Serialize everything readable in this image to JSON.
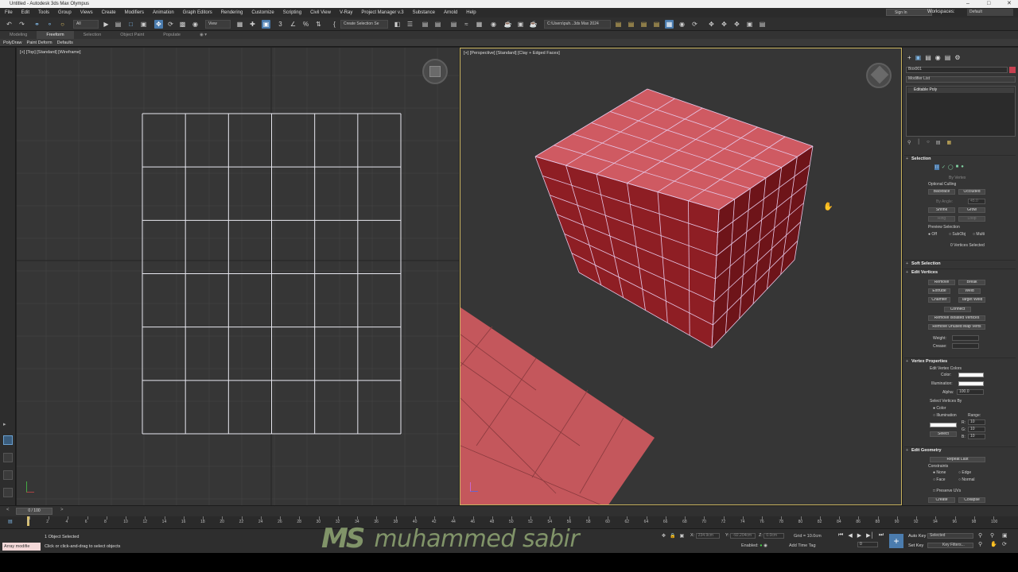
{
  "window": {
    "title": "Untitled - Autodesk 3ds Max Olympus"
  },
  "menu": [
    "File",
    "Edit",
    "Tools",
    "Group",
    "Views",
    "Create",
    "Modifiers",
    "Animation",
    "Graph Editors",
    "Rendering",
    "Customize",
    "Scripting",
    "Civil View",
    "V-Ray",
    "Project Manager v.3",
    "Substance",
    "Arnold",
    "Help"
  ],
  "account": {
    "signin": "Sign In",
    "workspaces_label": "Workspaces:",
    "workspace": "Default"
  },
  "toolbar": {
    "filter": "All",
    "refcoord": "View",
    "selection_set": "Create Selection Se",
    "project_path": "C:\\Users\\puh...3ds Max 2024"
  },
  "ribbon": {
    "tabs": [
      "Modeling",
      "Freeform",
      "Selection",
      "Object Paint",
      "Populate"
    ],
    "active": "Freeform",
    "sub": [
      "PolyDraw",
      "Paint Deform",
      "Defaults"
    ]
  },
  "viewports": {
    "left_label": "[+] [Top] [Standard] [Wireframe]",
    "right_label": "[+] [Perspective] [Standard] [Clay + Edged Faces]"
  },
  "command_panel": {
    "object_name": "Box001",
    "modifier_list": "Modifier List",
    "stack_item": "Editable Poly",
    "selection": {
      "header": "Selection",
      "by_vertex": "By Vertex",
      "optional_culling": "Optional Culling",
      "backface": "Backface",
      "occluded": "Occluded",
      "by_angle": "By Angle:",
      "angle_value": "45.0",
      "shrink": "Shrink",
      "grow": "Grow",
      "ring": "Ring",
      "loop": "Loop",
      "preview_selection": "Preview Selection",
      "off": "Off",
      "subobj": "SubObj",
      "multi": "Multi",
      "status": "0 Vertices Selected"
    },
    "soft_selection": "Soft Selection",
    "edit_vertices": {
      "header": "Edit Vertices",
      "remove": "Remove",
      "break": "Break",
      "extrude": "Extrude",
      "weld": "Weld",
      "chamfer": "Chamfer",
      "target_weld": "Target Weld",
      "connect": "Connect",
      "remove_isolated": "Remove Isolated Vertices",
      "remove_unused": "Remove Unused Map Verts",
      "weight": "Weight:",
      "crease": "Crease:"
    },
    "vertex_properties": {
      "header": "Vertex Properties",
      "edit_colors": "Edit Vertex Colors",
      "color": "Color:",
      "illumination": "Illumination:",
      "alpha": "Alpha:",
      "alpha_value": "100.0",
      "select_by": "Select Vertices By",
      "opt_color": "Color",
      "opt_illum": "Illumination",
      "range": "Range:",
      "r": "R:",
      "g": "G:",
      "b": "B:",
      "r_val": "10",
      "g_val": "10",
      "b_val": "10",
      "select": "Select"
    },
    "edit_geometry": {
      "header": "Edit Geometry",
      "repeat_last": "Repeat Last",
      "constraints": "Constraints",
      "none": "None",
      "edge": "Edge",
      "face": "Face",
      "normal": "Normal",
      "preserve_uvs": "Preserve UVs",
      "create": "Create",
      "collapse": "Collapse"
    }
  },
  "timeline": {
    "frame": "0 / 100",
    "ticks": [
      "0",
      "2",
      "4",
      "6",
      "8",
      "10",
      "12",
      "14",
      "16",
      "18",
      "20",
      "22",
      "24",
      "26",
      "28",
      "30",
      "32",
      "34",
      "36",
      "38",
      "40",
      "42",
      "44",
      "46",
      "48",
      "50",
      "52",
      "54",
      "56",
      "58",
      "60",
      "62",
      "64",
      "66",
      "68",
      "70",
      "72",
      "74",
      "76",
      "78",
      "80",
      "82",
      "84",
      "86",
      "88",
      "90",
      "92",
      "94",
      "96",
      "98",
      "100"
    ]
  },
  "status": {
    "script_field": "Array modifie",
    "objects": "1 Object Selected",
    "prompt": "Click or click-and-drag to select objects",
    "x_label": "X:",
    "x_val": "234.9cm",
    "y_label": "Y:",
    "y_val": "-92.204cm",
    "z_label": "Z:",
    "z_val": "0.0cm",
    "grid": "Grid = 10.0cm",
    "enabled": "Enabled:",
    "add_time_tag": "Add Time Tag",
    "auto_key": "Auto Key",
    "set_key": "Set Key",
    "key_mode": "Selected",
    "key_filters": "Key Filters...",
    "frame_field": "0"
  },
  "watermark": {
    "logo": "MS",
    "name": "muhammed sabir"
  },
  "colors": {
    "box_red": "#a83a42",
    "box_top": "#cf5a62",
    "floor": "#c4575c",
    "accent": "#4b7cae"
  }
}
